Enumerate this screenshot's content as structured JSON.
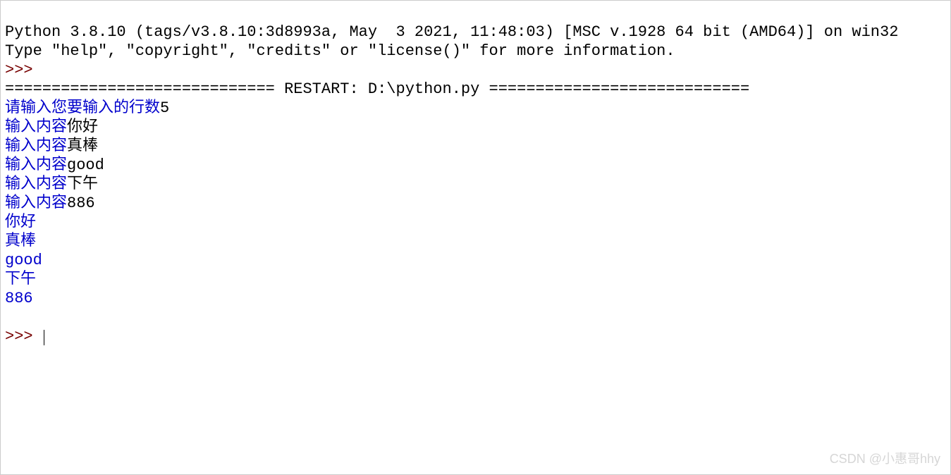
{
  "banner": {
    "line1": "Python 3.8.10 (tags/v3.8.10:3d8993a, May  3 2021, 11:48:03) [MSC v.1928 64 bit (AMD64)] on win32",
    "line2": "Type \"help\", \"copyright\", \"credits\" or \"license()\" for more information."
  },
  "prompt": ">>> ",
  "restart_line": "============================= RESTART: D:\\python.py ============================",
  "io_lines": [
    {
      "prompt": "请输入您要输入的行数",
      "input": "5"
    },
    {
      "prompt": "输入内容",
      "input": "你好"
    },
    {
      "prompt": "输入内容",
      "input": "真棒"
    },
    {
      "prompt": "输入内容",
      "input": "good"
    },
    {
      "prompt": "输入内容",
      "input": "下午"
    },
    {
      "prompt": "输入内容",
      "input": "886"
    }
  ],
  "output_lines": [
    "你好",
    "真棒",
    "good",
    "下午",
    "886"
  ],
  "watermark": "CSDN @小惠哥hhy"
}
